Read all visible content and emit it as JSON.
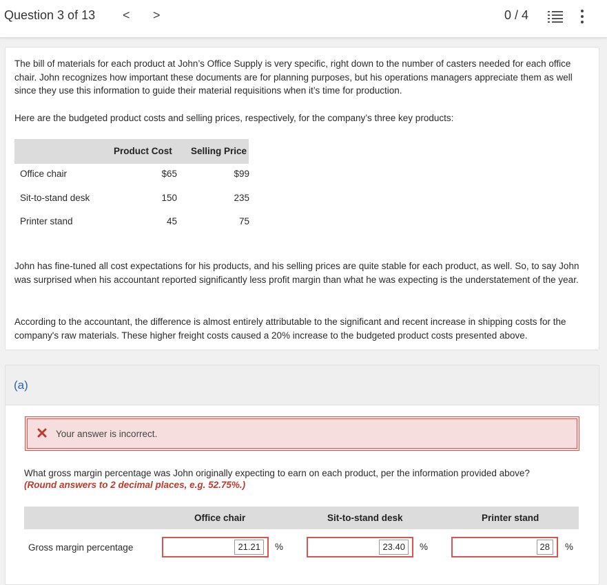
{
  "header": {
    "question_counter": "Question 3 of 13",
    "prev": "<",
    "next": ">",
    "score": "0 / 4",
    "list_icon": "list-icon",
    "more_icon": "vertical-ellipsis-icon"
  },
  "intro": {
    "p1": "The bill of materials for each product at John’s Office Supply is very specific, right down to the number of casters needed for each office chair. John recognizes how important these documents are for planning purposes, but his operations managers appreciate them as well since they use this information to guide their material requisitions when it’s time for production.",
    "p2": "Here are the budgeted product costs and selling prices, respectively, for the company’s three key products:",
    "p3": "John has fine-tuned all cost expectations for his products, and his selling prices are quite stable for each product, as well. So, to say John was surprised when his accountant reported significantly less profit margin than what he was expecting is the understatement of the year.",
    "p4": "According to the accountant, the difference is almost entirely attributable to the significant and recent increase in shipping costs for the company's raw materials. These higher freight costs caused a 20% increase to the budgeted product costs presented above."
  },
  "product_table": {
    "headers": [
      "Product Cost",
      "Selling Price"
    ],
    "rows": [
      {
        "name": "Office chair",
        "cost": "$65",
        "price": "$99"
      },
      {
        "name": "Sit-to-stand desk",
        "cost": "150",
        "price": "235"
      },
      {
        "name": "Printer stand",
        "cost": "45",
        "price": "75"
      }
    ]
  },
  "part": {
    "label": "(a)",
    "error_text": "Your answer is incorrect.",
    "question": "What gross margin percentage was John originally expecting to earn on each product, per the information provided above?",
    "note": "(Round answers to 2 decimal places, e.g. 52.75%.)",
    "columns": [
      "Office chair",
      "Sit-to-stand desk",
      "Printer stand"
    ],
    "row_label": "Gross margin percentage",
    "answers": [
      "21.21",
      "23.40",
      "28"
    ],
    "unit": "%"
  },
  "colors": {
    "error_border": "#d9534f",
    "error_bg": "#f7dede",
    "note_red": "#c0392b",
    "part_label_blue": "#2c63b0"
  }
}
